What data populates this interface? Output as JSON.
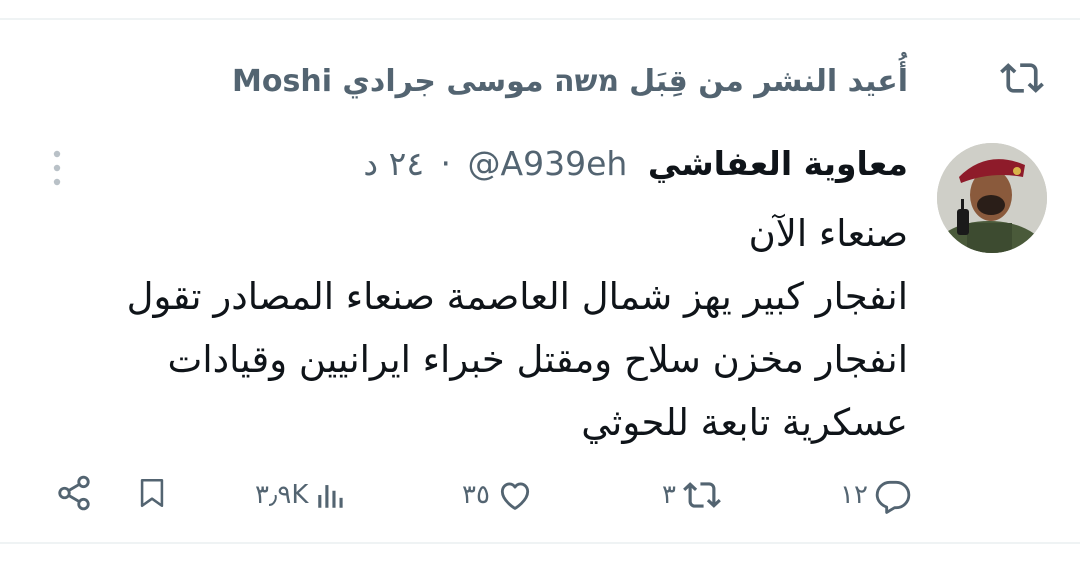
{
  "retweet": {
    "prefix": "أُعيد النشر من قِبَل",
    "name": "משה موسى جرادي Moshi"
  },
  "tweet": {
    "author_name": "معاوية العفاشي",
    "handle": "@A939eh",
    "separator": "·",
    "time": "٢٤ د",
    "lines": [
      "صنعاء الآن",
      "انفجار كبير يهز شمال العاصمة صنعاء المصادر تقول",
      "انفجار مخزن سلاح ومقتل خبراء ايرانيين وقيادات",
      "عسكرية تابعة للحوثي"
    ]
  },
  "actions": {
    "replies": "١٢",
    "retweets": "٣",
    "likes": "٣٥",
    "views": "٣٫٩K"
  },
  "icons": {
    "retweet": "retweet-icon",
    "more": "more-vertical-icon",
    "reply": "reply-icon",
    "like": "heart-icon",
    "views": "views-icon",
    "bookmark": "bookmark-icon",
    "share": "share-icon"
  },
  "colors": {
    "text": "#0f1419",
    "secondary": "#536471",
    "divider": "#eff3f4"
  }
}
